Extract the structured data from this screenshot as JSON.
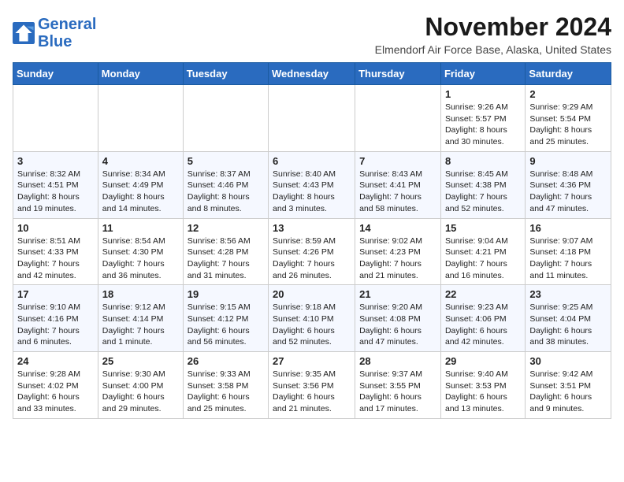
{
  "logo": {
    "line1": "General",
    "line2": "Blue"
  },
  "title": "November 2024",
  "location": "Elmendorf Air Force Base, Alaska, United States",
  "weekdays": [
    "Sunday",
    "Monday",
    "Tuesday",
    "Wednesday",
    "Thursday",
    "Friday",
    "Saturday"
  ],
  "weeks": [
    [
      {
        "day": "",
        "info": ""
      },
      {
        "day": "",
        "info": ""
      },
      {
        "day": "",
        "info": ""
      },
      {
        "day": "",
        "info": ""
      },
      {
        "day": "",
        "info": ""
      },
      {
        "day": "1",
        "info": "Sunrise: 9:26 AM\nSunset: 5:57 PM\nDaylight: 8 hours and 30 minutes."
      },
      {
        "day": "2",
        "info": "Sunrise: 9:29 AM\nSunset: 5:54 PM\nDaylight: 8 hours and 25 minutes."
      }
    ],
    [
      {
        "day": "3",
        "info": "Sunrise: 8:32 AM\nSunset: 4:51 PM\nDaylight: 8 hours and 19 minutes."
      },
      {
        "day": "4",
        "info": "Sunrise: 8:34 AM\nSunset: 4:49 PM\nDaylight: 8 hours and 14 minutes."
      },
      {
        "day": "5",
        "info": "Sunrise: 8:37 AM\nSunset: 4:46 PM\nDaylight: 8 hours and 8 minutes."
      },
      {
        "day": "6",
        "info": "Sunrise: 8:40 AM\nSunset: 4:43 PM\nDaylight: 8 hours and 3 minutes."
      },
      {
        "day": "7",
        "info": "Sunrise: 8:43 AM\nSunset: 4:41 PM\nDaylight: 7 hours and 58 minutes."
      },
      {
        "day": "8",
        "info": "Sunrise: 8:45 AM\nSunset: 4:38 PM\nDaylight: 7 hours and 52 minutes."
      },
      {
        "day": "9",
        "info": "Sunrise: 8:48 AM\nSunset: 4:36 PM\nDaylight: 7 hours and 47 minutes."
      }
    ],
    [
      {
        "day": "10",
        "info": "Sunrise: 8:51 AM\nSunset: 4:33 PM\nDaylight: 7 hours and 42 minutes."
      },
      {
        "day": "11",
        "info": "Sunrise: 8:54 AM\nSunset: 4:30 PM\nDaylight: 7 hours and 36 minutes."
      },
      {
        "day": "12",
        "info": "Sunrise: 8:56 AM\nSunset: 4:28 PM\nDaylight: 7 hours and 31 minutes."
      },
      {
        "day": "13",
        "info": "Sunrise: 8:59 AM\nSunset: 4:26 PM\nDaylight: 7 hours and 26 minutes."
      },
      {
        "day": "14",
        "info": "Sunrise: 9:02 AM\nSunset: 4:23 PM\nDaylight: 7 hours and 21 minutes."
      },
      {
        "day": "15",
        "info": "Sunrise: 9:04 AM\nSunset: 4:21 PM\nDaylight: 7 hours and 16 minutes."
      },
      {
        "day": "16",
        "info": "Sunrise: 9:07 AM\nSunset: 4:18 PM\nDaylight: 7 hours and 11 minutes."
      }
    ],
    [
      {
        "day": "17",
        "info": "Sunrise: 9:10 AM\nSunset: 4:16 PM\nDaylight: 7 hours and 6 minutes."
      },
      {
        "day": "18",
        "info": "Sunrise: 9:12 AM\nSunset: 4:14 PM\nDaylight: 7 hours and 1 minute."
      },
      {
        "day": "19",
        "info": "Sunrise: 9:15 AM\nSunset: 4:12 PM\nDaylight: 6 hours and 56 minutes."
      },
      {
        "day": "20",
        "info": "Sunrise: 9:18 AM\nSunset: 4:10 PM\nDaylight: 6 hours and 52 minutes."
      },
      {
        "day": "21",
        "info": "Sunrise: 9:20 AM\nSunset: 4:08 PM\nDaylight: 6 hours and 47 minutes."
      },
      {
        "day": "22",
        "info": "Sunrise: 9:23 AM\nSunset: 4:06 PM\nDaylight: 6 hours and 42 minutes."
      },
      {
        "day": "23",
        "info": "Sunrise: 9:25 AM\nSunset: 4:04 PM\nDaylight: 6 hours and 38 minutes."
      }
    ],
    [
      {
        "day": "24",
        "info": "Sunrise: 9:28 AM\nSunset: 4:02 PM\nDaylight: 6 hours and 33 minutes."
      },
      {
        "day": "25",
        "info": "Sunrise: 9:30 AM\nSunset: 4:00 PM\nDaylight: 6 hours and 29 minutes."
      },
      {
        "day": "26",
        "info": "Sunrise: 9:33 AM\nSunset: 3:58 PM\nDaylight: 6 hours and 25 minutes."
      },
      {
        "day": "27",
        "info": "Sunrise: 9:35 AM\nSunset: 3:56 PM\nDaylight: 6 hours and 21 minutes."
      },
      {
        "day": "28",
        "info": "Sunrise: 9:37 AM\nSunset: 3:55 PM\nDaylight: 6 hours and 17 minutes."
      },
      {
        "day": "29",
        "info": "Sunrise: 9:40 AM\nSunset: 3:53 PM\nDaylight: 6 hours and 13 minutes."
      },
      {
        "day": "30",
        "info": "Sunrise: 9:42 AM\nSunset: 3:51 PM\nDaylight: 6 hours and 9 minutes."
      }
    ]
  ]
}
